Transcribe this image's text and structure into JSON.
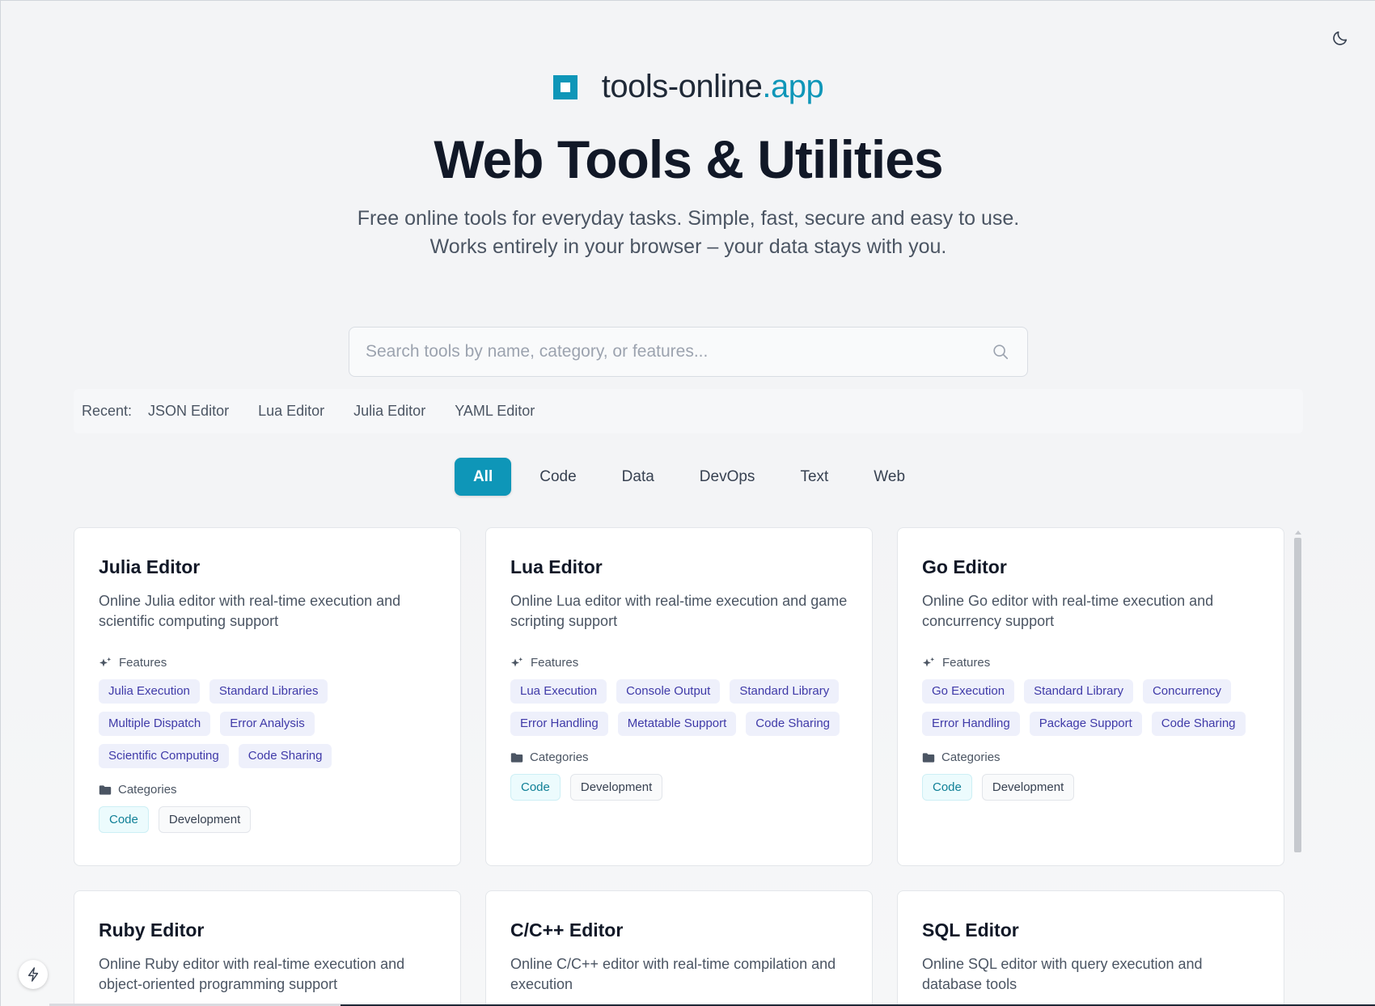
{
  "brand": {
    "name": "tools-online",
    "accent": ".app",
    "color": "#0e96b8"
  },
  "hero": {
    "title": "Web Tools & Utilities",
    "subtitle": "Free online tools for everyday tasks. Simple, fast, secure and easy to use. Works entirely in your browser – your data stays with you."
  },
  "search": {
    "placeholder": "Search tools by name, category, or features...",
    "value": ""
  },
  "recent": {
    "label": "Recent:",
    "items": [
      "JSON Editor",
      "Lua Editor",
      "Julia Editor",
      "YAML Editor"
    ]
  },
  "filters": {
    "active": "All",
    "tabs": [
      "All",
      "Code",
      "Data",
      "DevOps",
      "Text",
      "Web"
    ]
  },
  "labels": {
    "features": "Features",
    "categories": "Categories"
  },
  "cards": [
    {
      "title": "Julia Editor",
      "description": "Online Julia editor with real-time execution and scientific computing support",
      "features": [
        "Julia Execution",
        "Standard Libraries",
        "Multiple Dispatch",
        "Error Analysis",
        "Scientific Computing",
        "Code Sharing"
      ],
      "categories": [
        "Code",
        "Development"
      ]
    },
    {
      "title": "Lua Editor",
      "description": "Online Lua editor with real-time execution and game scripting support",
      "features": [
        "Lua Execution",
        "Console Output",
        "Standard Library",
        "Error Handling",
        "Metatable Support",
        "Code Sharing"
      ],
      "categories": [
        "Code",
        "Development"
      ]
    },
    {
      "title": "Go Editor",
      "description": "Online Go editor with real-time execution and concurrency support",
      "features": [
        "Go Execution",
        "Standard Library",
        "Concurrency",
        "Error Handling",
        "Package Support",
        "Code Sharing"
      ],
      "categories": [
        "Code",
        "Development"
      ]
    },
    {
      "title": "Ruby Editor",
      "description": "Online Ruby editor with real-time execution and object-oriented programming support",
      "features": [],
      "categories": []
    },
    {
      "title": "C/C++ Editor",
      "description": "Online C/C++ editor with real-time compilation and execution",
      "features": [],
      "categories": []
    },
    {
      "title": "SQL Editor",
      "description": "Online SQL editor with query execution and database tools",
      "features": [],
      "categories": []
    }
  ],
  "icons": {
    "theme": "moon-icon",
    "search": "search-icon",
    "features": "sparkles-icon",
    "categories": "folder-icon",
    "quick_action": "bolt-icon"
  }
}
